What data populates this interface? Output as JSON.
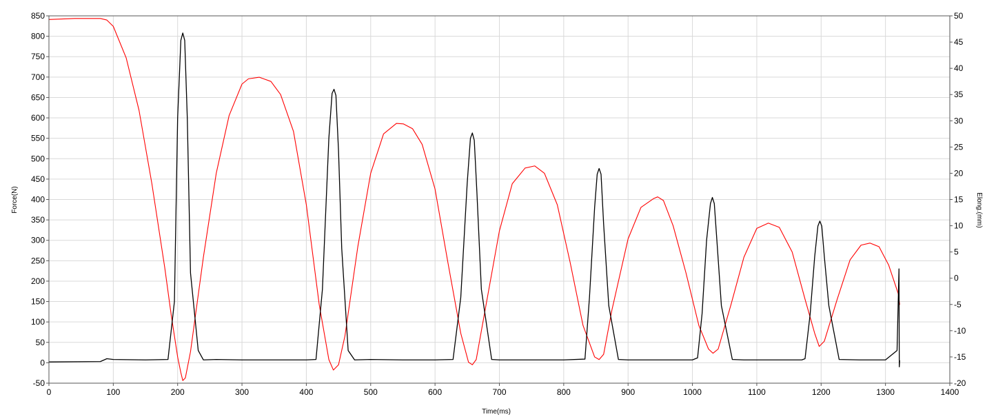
{
  "chart_data": {
    "type": "line",
    "title": "",
    "xlabel": "Time(ms)",
    "ylabel": "Force(N)",
    "y2label": "Elong.(mm)",
    "xlim": [
      0,
      1400
    ],
    "ylim": [
      -50,
      850
    ],
    "y2lim": [
      -20,
      50
    ],
    "grid": true,
    "legend": "none",
    "x_ticks": [
      0,
      100,
      200,
      300,
      400,
      500,
      600,
      700,
      800,
      900,
      1000,
      1100,
      1200,
      1300,
      1400
    ],
    "y_ticks": [
      -50,
      0,
      50,
      100,
      150,
      200,
      250,
      300,
      350,
      400,
      450,
      500,
      550,
      600,
      650,
      700,
      750,
      800,
      850
    ],
    "y2_ticks": [
      -20,
      -15,
      -10,
      -5,
      0,
      5,
      10,
      15,
      20,
      25,
      30,
      35,
      40,
      45,
      50
    ],
    "series": [
      {
        "axis": "left",
        "color": "#000000",
        "x": [
          0,
          80,
          90,
          100,
          150,
          185,
          195,
          200,
          205,
          208,
          211,
          215,
          220,
          232,
          240,
          260,
          300,
          350,
          400,
          415,
          425,
          435,
          440,
          443,
          446,
          450,
          455,
          465,
          475,
          500,
          550,
          600,
          628,
          640,
          650,
          655,
          658,
          661,
          665,
          672,
          688,
          700,
          750,
          800,
          833,
          840,
          848,
          852,
          855,
          858,
          862,
          870,
          885,
          900,
          950,
          1000,
          1008,
          1015,
          1022,
          1028,
          1031,
          1034,
          1038,
          1045,
          1062,
          1080,
          1120,
          1170,
          1175,
          1183,
          1190,
          1195,
          1198,
          1201,
          1205,
          1212,
          1228,
          1260,
          1300,
          1318,
          1321,
          1321.5,
          1322
        ],
        "values": [
          2,
          3,
          10,
          8,
          7,
          8,
          150,
          600,
          790,
          808,
          790,
          600,
          220,
          30,
          7,
          8,
          7,
          7,
          7,
          8,
          180,
          550,
          660,
          670,
          655,
          520,
          280,
          30,
          7,
          8,
          7,
          7,
          8,
          160,
          440,
          550,
          563,
          545,
          420,
          180,
          8,
          7,
          7,
          7,
          9,
          160,
          380,
          462,
          476,
          462,
          340,
          140,
          8,
          7,
          7,
          7,
          12,
          120,
          300,
          390,
          405,
          390,
          300,
          140,
          8,
          7,
          7,
          7,
          10,
          120,
          260,
          335,
          347,
          335,
          260,
          140,
          8,
          7,
          7,
          30,
          230,
          -10,
          5
        ]
      },
      {
        "axis": "right",
        "color": "#ff0000",
        "x": [
          0,
          20,
          40,
          60,
          80,
          90,
          100,
          120,
          140,
          160,
          180,
          190,
          200,
          205,
          208,
          212,
          220,
          240,
          260,
          280,
          300,
          310,
          327,
          345,
          360,
          380,
          400,
          420,
          435,
          442,
          450,
          460,
          480,
          500,
          520,
          540,
          551,
          565,
          580,
          600,
          620,
          640,
          652,
          658,
          664,
          675,
          700,
          720,
          740,
          755,
          770,
          790,
          810,
          830,
          848,
          855,
          862,
          875,
          900,
          920,
          940,
          946,
          955,
          970,
          990,
          1010,
          1025,
          1032,
          1040,
          1060,
          1080,
          1100,
          1118,
          1135,
          1155,
          1175,
          1190,
          1197,
          1205,
          1225,
          1245,
          1262,
          1276,
          1290,
          1305,
          1320,
          1322
        ],
        "values": [
          49.3,
          49.4,
          49.5,
          49.5,
          49.5,
          49.2,
          48.0,
          42.0,
          32.0,
          18.0,
          2.0,
          -7.0,
          -15.0,
          -18.0,
          -19.5,
          -19.0,
          -14.0,
          4.0,
          20.0,
          31.0,
          37.0,
          38.0,
          38.3,
          37.5,
          35.0,
          28.0,
          14.0,
          -5.0,
          -15.5,
          -17.5,
          -16.5,
          -11.0,
          6.0,
          20.0,
          27.5,
          29.5,
          29.4,
          28.5,
          25.5,
          17.0,
          3.0,
          -10.5,
          -16.0,
          -16.5,
          -15.5,
          -8.0,
          9.0,
          18.0,
          21.0,
          21.4,
          20.0,
          14.0,
          3.0,
          -9.0,
          -15.0,
          -15.5,
          -14.5,
          -6.0,
          7.5,
          13.5,
          15.2,
          15.5,
          14.8,
          10.0,
          1.0,
          -9.0,
          -13.5,
          -14.3,
          -13.5,
          -5.0,
          4.0,
          9.5,
          10.5,
          9.7,
          5.0,
          -4.0,
          -10.5,
          -13.0,
          -12.0,
          -4.0,
          3.5,
          6.3,
          6.7,
          6.0,
          2.5,
          -3.0,
          -5.0
        ]
      }
    ]
  }
}
